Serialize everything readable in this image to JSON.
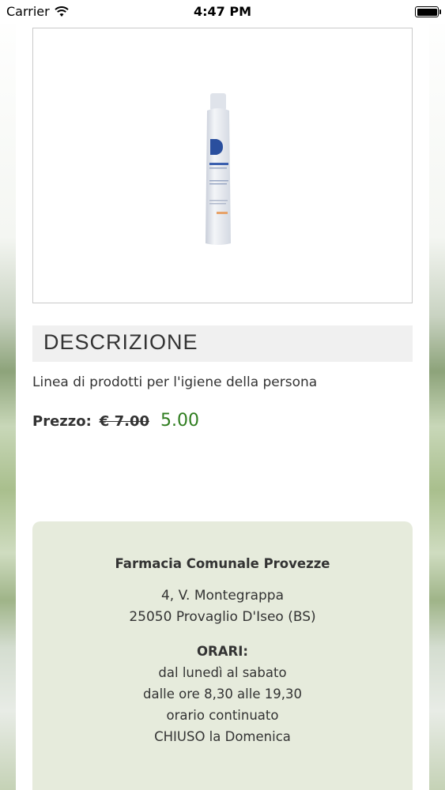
{
  "statusbar": {
    "carrier": "Carrier",
    "time": "4:47 PM",
    "wifi_icon": "wifi-icon",
    "battery_icon": "battery-icon"
  },
  "product": {
    "image_icon": "shampoo-bottle-image",
    "section_title": "DESCRIZIONE",
    "description": "Linea di prodotti per l'igiene della persona",
    "price_label": "Prezzo:",
    "price_old": "€ 7.00",
    "price_new": "5.00"
  },
  "pharmacy": {
    "name": "Farmacia Comunale Provezze",
    "address_line1": "4, V. Montegrappa",
    "address_line2": "25050 Provaglio D'Iseo (BS)",
    "hours_title": "ORARI:",
    "hours_line1": "dal lunedì al sabato",
    "hours_line2": "dalle ore 8,30 alle 19,30",
    "hours_line3": "orario continuato",
    "hours_line4": "CHIUSO la Domenica"
  },
  "colors": {
    "price_new": "#2f7d1f",
    "info_box_bg": "#e6ebdc",
    "desc_header_bg": "#f0f0f0"
  }
}
